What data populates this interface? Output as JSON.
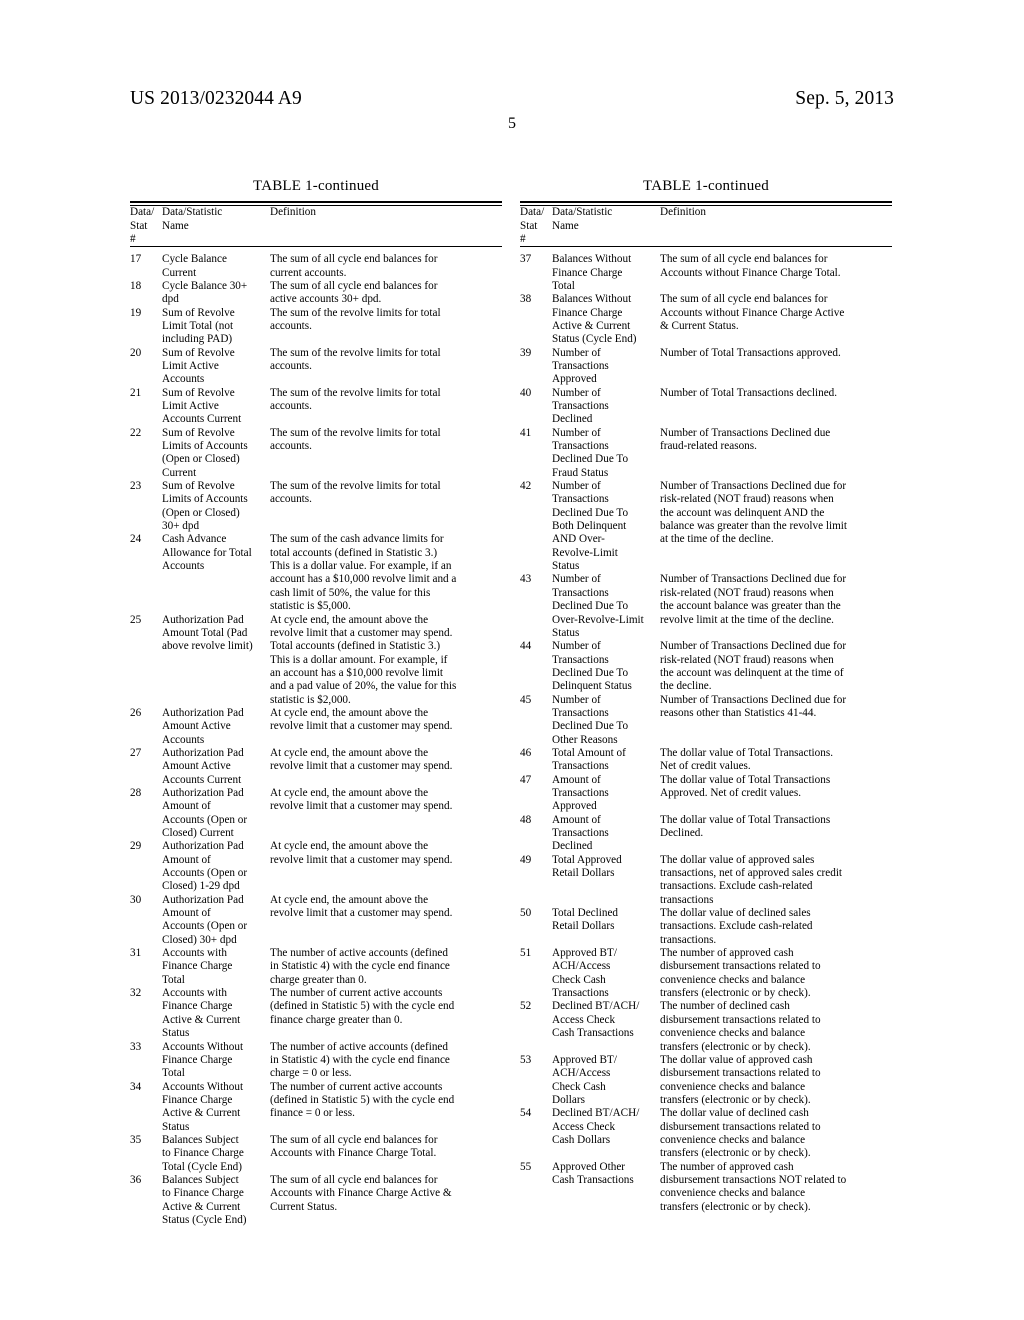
{
  "header": {
    "publication_number": "US 2013/0232044 A9",
    "publication_date": "Sep. 5, 2013",
    "page_number": "5"
  },
  "table_caption": "TABLE 1-continued",
  "column_headers": {
    "num": "Data/\nStat\n#",
    "name": "Data/Statistic\nName",
    "definition": "Definition"
  },
  "left_column": {
    "caption": "TABLE 1-continued",
    "rows": [
      {
        "num": "17",
        "name": "Cycle Balance\nCurrent",
        "definition": "The sum of all cycle end balances for\ncurrent accounts."
      },
      {
        "num": "18",
        "name": "Cycle Balance 30+\ndpd",
        "definition": "The sum of all cycle end balances for\nactive accounts 30+ dpd."
      },
      {
        "num": "19",
        "name": "Sum of Revolve\nLimit Total (not\nincluding PAD)",
        "definition": "The sum of the revolve limits for total\naccounts."
      },
      {
        "num": "20",
        "name": "Sum of Revolve\nLimit Active\nAccounts",
        "definition": "The sum of the revolve limits for total\naccounts."
      },
      {
        "num": "21",
        "name": "Sum of Revolve\nLimit Active\nAccounts Current",
        "definition": "The sum of the revolve limits for total\naccounts."
      },
      {
        "num": "22",
        "name": "Sum of Revolve\nLimits of Accounts\n(Open or Closed)\nCurrent",
        "definition": "The sum of the revolve limits for total\naccounts."
      },
      {
        "num": "23",
        "name": "Sum of Revolve\nLimits of Accounts\n(Open or Closed)\n30+ dpd",
        "definition": "The sum of the revolve limits for total\naccounts."
      },
      {
        "num": "24",
        "name": "Cash Advance\nAllowance for Total\nAccounts",
        "definition": "The sum of the cash advance limits for\ntotal accounts (defined in Statistic 3.)\nThis is a dollar value. For example, if an\naccount has a $10,000 revolve limit and a\ncash limit of 50%, the value for this\nstatistic is $5,000."
      },
      {
        "num": "25",
        "name": "Authorization Pad\nAmount Total (Pad\nabove revolve limit)",
        "definition": "At cycle end, the amount above the\nrevolve limit that a customer may spend.\nTotal accounts (defined in Statistic 3.)\nThis is a dollar amount. For example, if\nan account has a $10,000 revolve limit\nand a pad value of 20%, the value for this\nstatistic is $2,000."
      },
      {
        "num": "26",
        "name": "Authorization Pad\nAmount Active\nAccounts",
        "definition": "At cycle end, the amount above the\nrevolve limit that a customer may spend."
      },
      {
        "num": "27",
        "name": "Authorization Pad\nAmount Active\nAccounts Current",
        "definition": "At cycle end, the amount above the\nrevolve limit that a customer may spend."
      },
      {
        "num": "28",
        "name": "Authorization Pad\nAmount of\nAccounts (Open or\nClosed) Current",
        "definition": "At cycle end, the amount above the\nrevolve limit that a customer may spend."
      },
      {
        "num": "29",
        "name": "Authorization Pad\nAmount of\nAccounts (Open or\nClosed) 1-29 dpd",
        "definition": "At cycle end, the amount above the\nrevolve limit that a customer may spend."
      },
      {
        "num": "30",
        "name": "Authorization Pad\nAmount of\nAccounts (Open or\nClosed) 30+ dpd",
        "definition": "At cycle end, the amount above the\nrevolve limit that a customer may spend."
      },
      {
        "num": "31",
        "name": "Accounts with\nFinance Charge\nTotal",
        "definition": "The number of active accounts (defined\nin Statistic 4) with the cycle end finance\ncharge greater than 0."
      },
      {
        "num": "32",
        "name": "Accounts with\nFinance Charge\nActive & Current\nStatus",
        "definition": "The number of current active accounts\n(defined in Statistic 5) with the cycle end\nfinance charge greater than 0."
      },
      {
        "num": "33",
        "name": "Accounts Without\nFinance Charge\nTotal",
        "definition": "The number of active accounts (defined\nin Statistic 4) with the cycle end finance\ncharge = 0 or less."
      },
      {
        "num": "34",
        "name": "Accounts Without\nFinance Charge\nActive & Current\nStatus",
        "definition": "The number of current active accounts\n(defined in Statistic 5) with the cycle end\nfinance = 0 or less."
      },
      {
        "num": "35",
        "name": "Balances Subject\nto Finance Charge\nTotal (Cycle End)",
        "definition": "The sum of all cycle end balances for\nAccounts with Finance Charge Total."
      },
      {
        "num": "36",
        "name": "Balances Subject\nto Finance Charge\nActive & Current\nStatus (Cycle End)",
        "definition": "The sum of all cycle end balances for\nAccounts with Finance Charge Active &\nCurrent Status."
      }
    ]
  },
  "right_column": {
    "caption": "TABLE 1-continued",
    "rows": [
      {
        "num": "37",
        "name": "Balances Without\nFinance Charge\nTotal",
        "definition": "The sum of all cycle end balances for\nAccounts without Finance Charge Total."
      },
      {
        "num": "38",
        "name": "Balances Without\nFinance Charge\nActive & Current\nStatus (Cycle End)",
        "definition": "The sum of all cycle end balances for\nAccounts without Finance Charge Active\n& Current Status."
      },
      {
        "num": "39",
        "name": "Number of\nTransactions\nApproved",
        "definition": "Number of Total Transactions approved."
      },
      {
        "num": "40",
        "name": "Number of\nTransactions\nDeclined",
        "definition": "Number of Total Transactions declined."
      },
      {
        "num": "41",
        "name": "Number of\nTransactions\nDeclined Due To\nFraud Status",
        "definition": "Number of Transactions Declined due\nfraud-related reasons."
      },
      {
        "num": "42",
        "name": "Number of\nTransactions\nDeclined Due To\nBoth Delinquent\nAND Over-\nRevolve-Limit\nStatus",
        "definition": "Number of Transactions Declined due for\nrisk-related (NOT fraud) reasons when\nthe account was delinquent AND the\nbalance was greater than the revolve limit\nat the time of the decline."
      },
      {
        "num": "43",
        "name": "Number of\nTransactions\nDeclined Due To\nOver-Revolve-Limit\nStatus",
        "definition": "Number of Transactions Declined due for\nrisk-related (NOT fraud) reasons when\nthe account balance was greater than the\nrevolve limit at the time of the decline."
      },
      {
        "num": "44",
        "name": "Number of\nTransactions\nDeclined Due To\nDelinquent Status",
        "definition": "Number of Transactions Declined due for\nrisk-related (NOT fraud) reasons when\nthe account was delinquent at the time of\nthe decline."
      },
      {
        "num": "45",
        "name": "Number of\nTransactions\nDeclined Due To\nOther Reasons",
        "definition": "Number of Transactions Declined due for\nreasons other than Statistics 41-44."
      },
      {
        "num": "46",
        "name": "Total Amount of\nTransactions",
        "definition": "The dollar value of Total Transactions.\nNet of credit values."
      },
      {
        "num": "47",
        "name": "Amount of\nTransactions\nApproved",
        "definition": "The dollar value of Total Transactions\nApproved. Net of credit values."
      },
      {
        "num": "48",
        "name": "Amount of\nTransactions\nDeclined",
        "definition": "The dollar value of Total Transactions\nDeclined."
      },
      {
        "num": "49",
        "name": "Total Approved\nRetail Dollars",
        "definition": "The dollar value of approved sales\ntransactions, net of approved sales credit\ntransactions. Exclude cash-related\ntransactions"
      },
      {
        "num": "50",
        "name": "Total Declined\nRetail Dollars",
        "definition": "The dollar value of declined sales\ntransactions. Exclude cash-related\ntransactions."
      },
      {
        "num": "51",
        "name": "Approved BT/\nACH/Access\nCheck Cash\nTransactions",
        "definition": "The number of approved cash\ndisbursement transactions related to\nconvenience checks and balance\ntransfers (electronic or by check)."
      },
      {
        "num": "52",
        "name": "Declined BT/ACH/\nAccess Check\nCash Transactions",
        "definition": "The number of declined cash\ndisbursement transactions related to\nconvenience checks and balance\ntransfers (electronic or by check)."
      },
      {
        "num": "53",
        "name": "Approved BT/\nACH/Access\nCheck Cash\nDollars",
        "definition": "The dollar value of approved cash\ndisbursement transactions related to\nconvenience checks and balance\ntransfers (electronic or by check)."
      },
      {
        "num": "54",
        "name": "Declined BT/ACH/\nAccess Check\nCash Dollars",
        "definition": "The dollar value of declined cash\ndisbursement transactions related to\nconvenience checks and balance\ntransfers (electronic or by check)."
      },
      {
        "num": "55",
        "name": "Approved Other\nCash Transactions",
        "definition": "The number of approved cash\ndisbursement transactions NOT related to\nconvenience checks and balance\ntransfers (electronic or by check)."
      }
    ]
  }
}
